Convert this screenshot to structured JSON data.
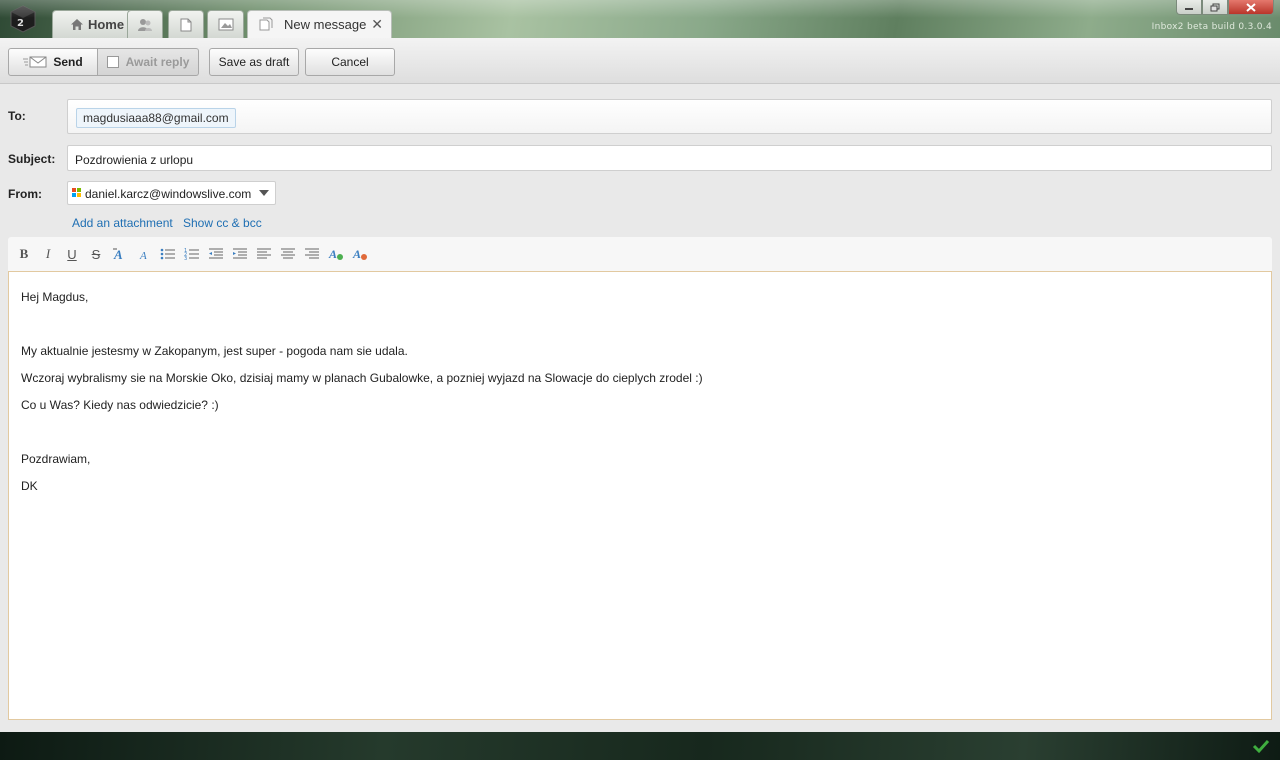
{
  "window": {
    "build": "Inbox2 beta build 0.3.0.4"
  },
  "tabs": {
    "home_label": "Home",
    "new_message_label": "New message",
    "close_symbol": "✕"
  },
  "toolbar": {
    "send_label": "Send",
    "await_reply_label": "Await reply",
    "save_draft_label": "Save as draft",
    "cancel_label": "Cancel"
  },
  "form": {
    "to_label": "To:",
    "to_recipients": [
      "magdusiaaa88@gmail.com"
    ],
    "subject_label": "Subject:",
    "subject_value": "Pozdrowienia z urlopu",
    "from_label": "From:",
    "from_value": "daniel.karcz@windowslive.com",
    "add_attachment_label": "Add an attachment",
    "show_cc_bcc_label": "Show cc & bcc"
  },
  "editor_toolbar": {
    "bold": "B",
    "italic": "I",
    "underline": "U",
    "strike": "S"
  },
  "body": {
    "lines": [
      "Hej Magdus,",
      "My aktualnie jestesmy w Zakopanym, jest super - pogoda nam sie udala.",
      "Wczoraj wybralismy sie na Morskie Oko, dzisiaj mamy w planach Gubalowke, a pozniej wyjazd na Slowacje do cieplych zrodel :)",
      "Co u Was? Kiedy nas odwiedzicie? :)",
      "Pozdrawiam,",
      "DK"
    ]
  },
  "colors": {
    "link": "#1f6fb3",
    "status_ok": "#3fae3f",
    "editor_border": "#e2c9a0"
  }
}
